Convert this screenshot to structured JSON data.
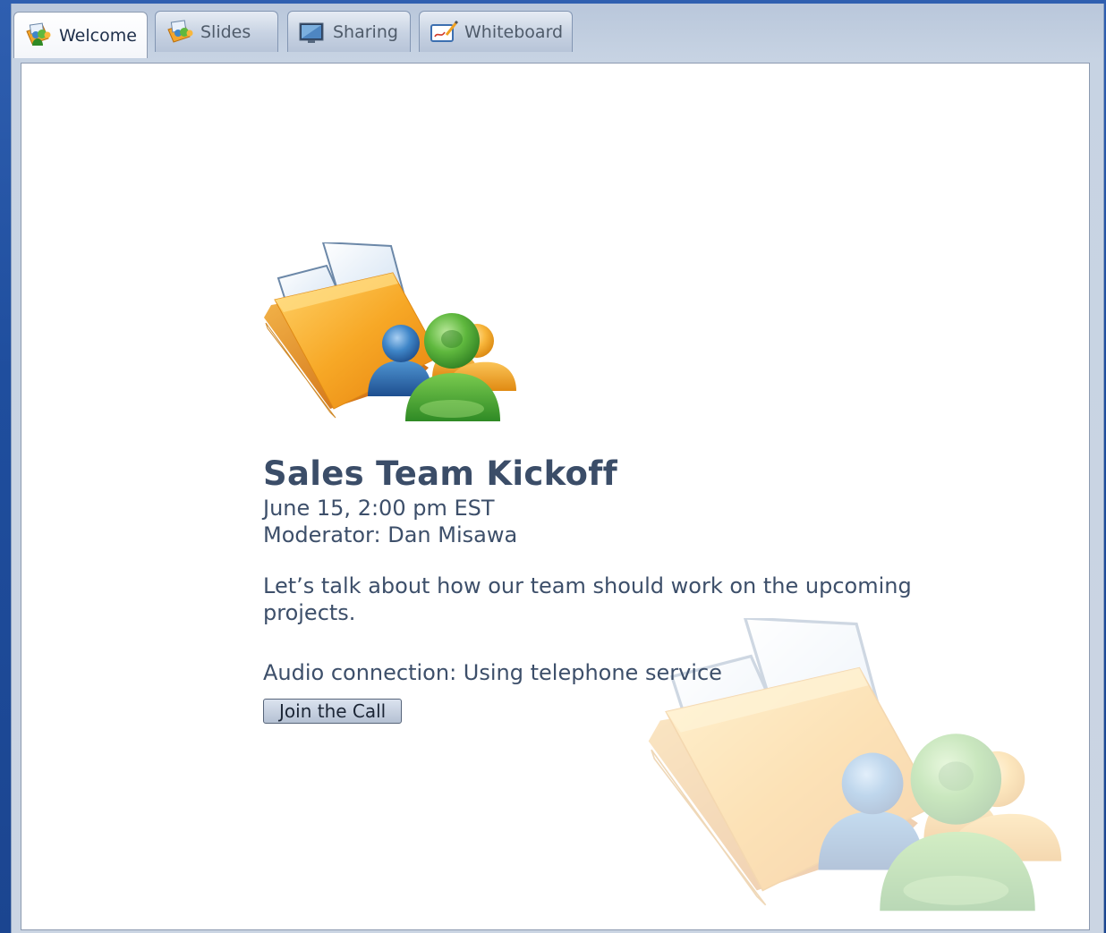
{
  "tabs": [
    {
      "label": "Welcome",
      "icon": "welcome-icon",
      "active": true
    },
    {
      "label": "Slides",
      "icon": "slides-icon",
      "active": false
    },
    {
      "label": "Sharing",
      "icon": "sharing-icon",
      "active": false
    },
    {
      "label": "Whiteboard",
      "icon": "whiteboard-icon",
      "active": false
    }
  ],
  "meeting": {
    "title": "Sales Team Kickoff",
    "datetime": "June 15, 2:00 pm EST",
    "moderator": "Moderator: Dan Misawa",
    "description": "Let’s talk about how our team should work on the upcoming projects.",
    "audio": "Audio connection: Using telephone service",
    "join_label": "Join the Call"
  },
  "colors": {
    "desktop_blue": "#1f4e9e",
    "frame": "#c7d3e3",
    "title_text": "#3b4d68",
    "folder_orange": "#f4a21c",
    "person_green": "#4ca436",
    "person_blue": "#2f6fb0",
    "person_orange": "#f6b43a"
  }
}
